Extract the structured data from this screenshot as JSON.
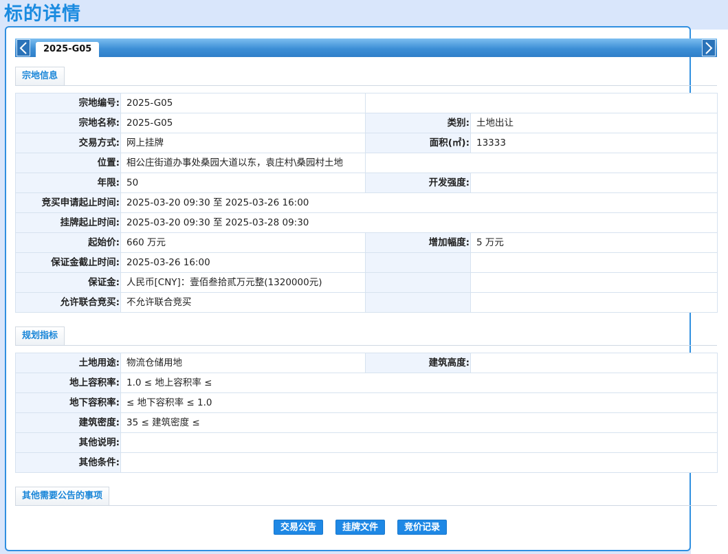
{
  "page": {
    "title": "标的详情"
  },
  "tabs": {
    "active_label": "2025-G05"
  },
  "sections": {
    "parcel_info": "宗地信息",
    "planning": "规划指标",
    "other_notices": "其他需要公告的事项"
  },
  "parcel": {
    "rows": [
      {
        "l1": "宗地编号:",
        "v1": "2025-G05"
      },
      {
        "l1": "宗地名称:",
        "v1": "2025-G05",
        "l2": "类别:",
        "v2": "土地出让"
      },
      {
        "l1": "交易方式:",
        "v1": "网上挂牌",
        "l2": "面积(㎡):",
        "v2": "13333"
      },
      {
        "l1": "位置:",
        "v1": "相公庄街道办事处桑园大道以东，袁庄村\\桑园村土地"
      },
      {
        "l1": "年限:",
        "v1": "50",
        "l2": "开发强度:",
        "v2": ""
      },
      {
        "l1": "竞买申请起止时间:",
        "v1": "2025-03-20 09:30 至 2025-03-26 16:00"
      },
      {
        "l1": "挂牌起止时间:",
        "v1": "2025-03-20 09:30 至 2025-03-28 09:30"
      },
      {
        "l1": "起始价:",
        "v1": "660 万元",
        "l2": "增加幅度:",
        "v2": "5 万元"
      },
      {
        "l1": "保证金截止时间:",
        "v1": "2025-03-26 16:00"
      },
      {
        "l1": "保证金:",
        "v1": "人民币[CNY]：壹佰叁拾贰万元整(1320000元)"
      },
      {
        "l1": "允许联合竞买:",
        "v1": "不允许联合竞买"
      }
    ]
  },
  "planning": {
    "rows": [
      {
        "l1": "土地用途:",
        "v1": "物流仓储用地",
        "l2": "建筑高度:",
        "v2": ""
      },
      {
        "l1": "地上容积率:",
        "v1": "1.0 ≤ 地上容积率 ≤"
      },
      {
        "l1": "地下容积率:",
        "v1": "≤ 地下容积率 ≤ 1.0"
      },
      {
        "l1": "建筑密度:",
        "v1": "35 ≤ 建筑密度 ≤"
      },
      {
        "l1": "其他说明:",
        "v1": ""
      },
      {
        "l1": "其他条件:",
        "v1": ""
      }
    ]
  },
  "buttons": {
    "announcement": "交易公告",
    "listing_docs": "挂牌文件",
    "bid_records": "竞价记录"
  },
  "icons": {
    "prev": "chevron-left-icon",
    "next": "chevron-right-icon"
  },
  "colors": {
    "accent": "#1a8be0",
    "label_bg": "#eef4fd",
    "button": "#1e88e5"
  }
}
